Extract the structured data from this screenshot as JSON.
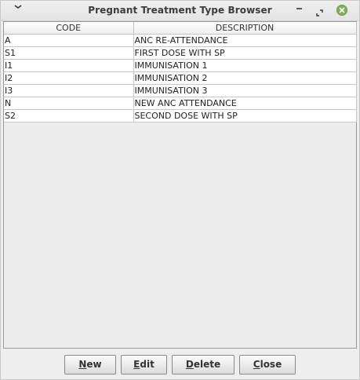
{
  "window": {
    "title": "Pregnant Treatment Type Browser",
    "close_color": "#7fb25a"
  },
  "table": {
    "columns": [
      "CODE",
      "DESCRIPTION"
    ],
    "rows": [
      [
        "A",
        "ANC RE-ATTENDANCE"
      ],
      [
        "S1",
        "FIRST DOSE WITH SP"
      ],
      [
        "I1",
        "IMMUNISATION 1"
      ],
      [
        "I2",
        "IMMUNISATION 2"
      ],
      [
        "I3",
        "IMMUNISATION 3"
      ],
      [
        "N",
        "NEW ANC ATTENDANCE"
      ],
      [
        "S2",
        "SECOND DOSE WITH SP"
      ]
    ]
  },
  "buttons": {
    "new": {
      "mnemonic": "N",
      "rest": "ew"
    },
    "edit": {
      "mnemonic": "E",
      "rest": "dit"
    },
    "delete": {
      "mnemonic": "D",
      "rest": "elete"
    },
    "close": {
      "mnemonic": "C",
      "rest": "lose"
    }
  }
}
